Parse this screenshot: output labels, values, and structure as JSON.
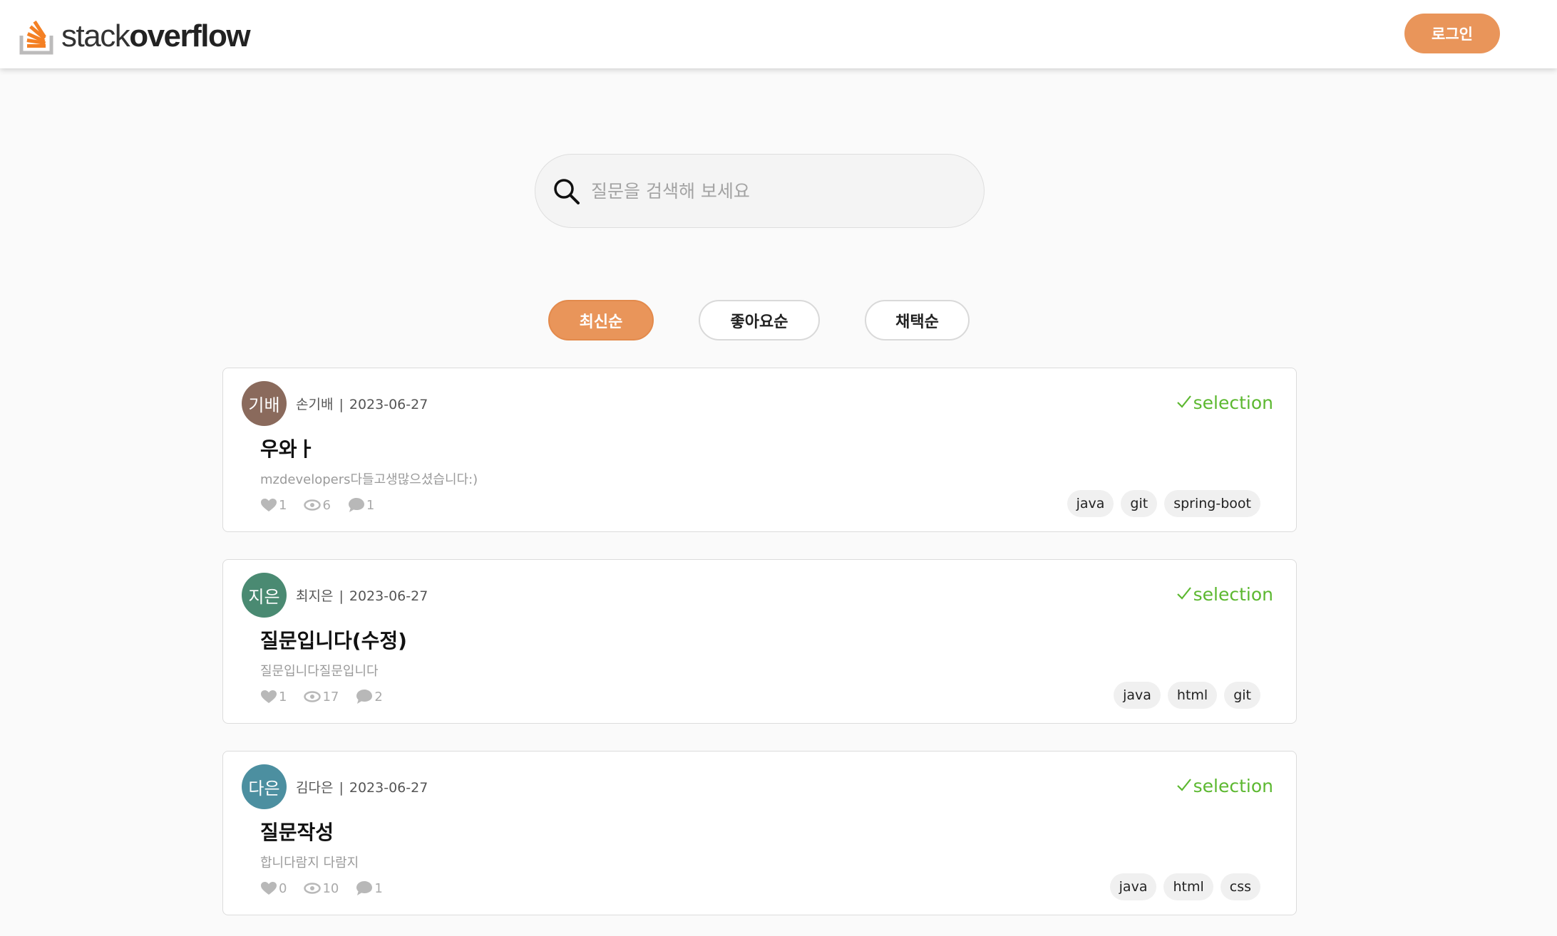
{
  "header": {
    "logo_text_light": "stack",
    "logo_text_bold": "overflow",
    "login_label": "로그인"
  },
  "search": {
    "placeholder": "질문을 검색해 보세요",
    "value": ""
  },
  "sort_tabs": [
    {
      "label": "최신순",
      "active": true
    },
    {
      "label": "좋아요순",
      "active": false
    },
    {
      "label": "채택순",
      "active": false
    }
  ],
  "questions": [
    {
      "avatar_text": "기배",
      "avatar_color": "#8a6a5c",
      "author": "손기배",
      "separator": "|",
      "date": "2023-06-27",
      "selection_label": "selection",
      "title": "우와ㅏ",
      "excerpt": "mzdevelopers다들고생많으셨습니다:)",
      "likes": "1",
      "views": "6",
      "comments": "1",
      "tags": [
        "java",
        "git",
        "spring-boot"
      ]
    },
    {
      "avatar_text": "지은",
      "avatar_color": "#4a8a72",
      "author": "최지은",
      "separator": "|",
      "date": "2023-06-27",
      "selection_label": "selection",
      "title": "질문입니다(수정)",
      "excerpt": "질문입니다질문입니다",
      "likes": "1",
      "views": "17",
      "comments": "2",
      "tags": [
        "java",
        "html",
        "git"
      ]
    },
    {
      "avatar_text": "다은",
      "avatar_color": "#4c8fa0",
      "author": "김다은",
      "separator": "|",
      "date": "2023-06-27",
      "selection_label": "selection",
      "title": "질문작성",
      "excerpt": "합니다람지 다람지",
      "likes": "0",
      "views": "10",
      "comments": "1",
      "tags": [
        "java",
        "html",
        "css"
      ]
    }
  ],
  "colors": {
    "accent": "#e9955a",
    "selection_green": "#5cb830",
    "stat_gray": "#aaaaaa"
  },
  "icons": {
    "like": "heart-icon",
    "views": "eye-icon",
    "comments": "speech-bubble-icon",
    "selection": "checkmark-icon",
    "search": "magnifier-icon",
    "logo": "stackoverflow-logo-icon"
  }
}
